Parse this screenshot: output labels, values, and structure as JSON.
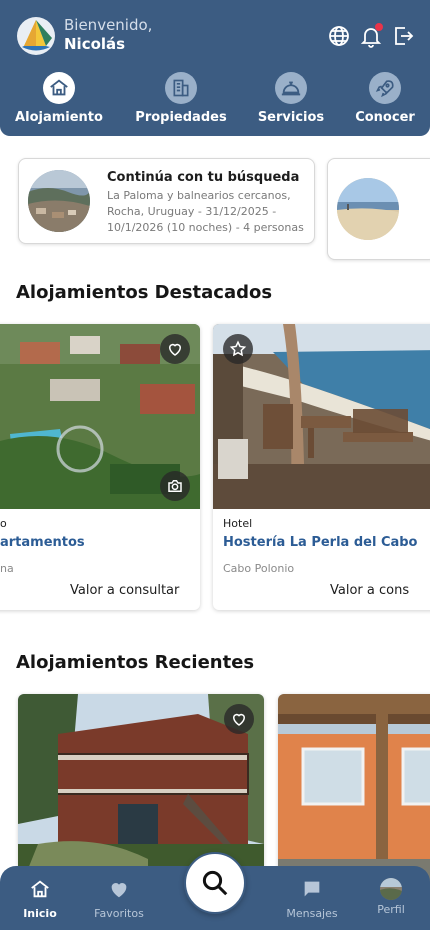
{
  "header": {
    "greeting": "Bienvenido,",
    "user_name": "Nicolás",
    "icons": [
      "logo-icon",
      "globe-icon",
      "bell-icon",
      "logout-icon"
    ],
    "notification_color": "#e8344a"
  },
  "categories": [
    {
      "label": "Alojamiento",
      "icon": "house-icon",
      "active": true
    },
    {
      "label": "Propiedades",
      "icon": "building-icon",
      "active": false
    },
    {
      "label": "Servicios",
      "icon": "service-bell-icon",
      "active": false
    },
    {
      "label": "Conocer",
      "icon": "rocket-icon",
      "active": false
    }
  ],
  "search_history": {
    "title": "Continúa con tu búsqueda",
    "description": "La Paloma y balnearios cercanos, Rocha, Uruguay - 31/12/2025 - 10/1/2026 (10 noches) - 4 personas"
  },
  "featured": {
    "title": "Alojamientos Destacados",
    "items": [
      {
        "type": "o",
        "name": "artamentos",
        "location": "na",
        "price": "Valor a consultar"
      },
      {
        "type": "Hotel",
        "name": "Hostería La Perla del Cabo",
        "location": "Cabo Polonio",
        "price": "Valor a cons"
      }
    ]
  },
  "recent": {
    "title": "Alojamientos Recientes"
  },
  "bottom_nav": {
    "items": [
      {
        "label": "Inicio",
        "icon": "home-icon",
        "active": true
      },
      {
        "label": "Favoritos",
        "icon": "heart-icon",
        "active": false
      },
      {
        "label": "Mensajes",
        "icon": "chat-icon",
        "active": false
      },
      {
        "label": "Perfil",
        "icon": "avatar",
        "active": false
      }
    ]
  },
  "colors": {
    "brand": "#3c5c82",
    "link": "#2c5c95"
  }
}
